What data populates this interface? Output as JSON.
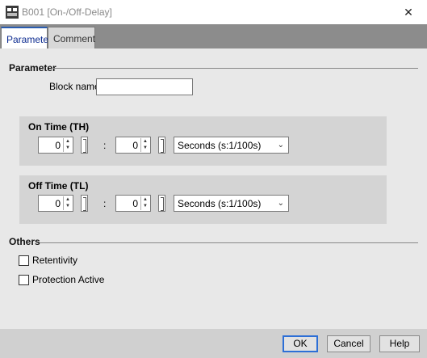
{
  "window": {
    "title": "B001 [On-/Off-Delay]"
  },
  "tabs": [
    {
      "label": "Parameter",
      "active": true
    },
    {
      "label": "Comment",
      "active": false
    }
  ],
  "parameter": {
    "section_label": "Parameter",
    "block_name_label": "Block name:",
    "block_name_value": ""
  },
  "on_time": {
    "title": "On Time (TH)",
    "value1": "0",
    "value2": "0",
    "colon": ":",
    "unit": "Seconds (s:1/100s)"
  },
  "off_time": {
    "title": "Off Time (TL)",
    "value1": "0",
    "value2": "0",
    "colon": ":",
    "unit": "Seconds (s:1/100s)"
  },
  "others": {
    "section_label": "Others",
    "retentivity": {
      "label": "Retentivity",
      "checked": false
    },
    "protection": {
      "label": "Protection Active",
      "checked": false
    }
  },
  "buttons": {
    "ok": "OK",
    "cancel": "Cancel",
    "help": "Help"
  },
  "icons": {
    "close": "close-icon",
    "spin_up": "▲",
    "spin_down": "▼",
    "dropdown": "chevron-down-icon"
  },
  "colors": {
    "tab_active_text": "#0b2a8f",
    "ok_border": "#2d6fd6",
    "tabstrip": "#8c8c8c"
  }
}
